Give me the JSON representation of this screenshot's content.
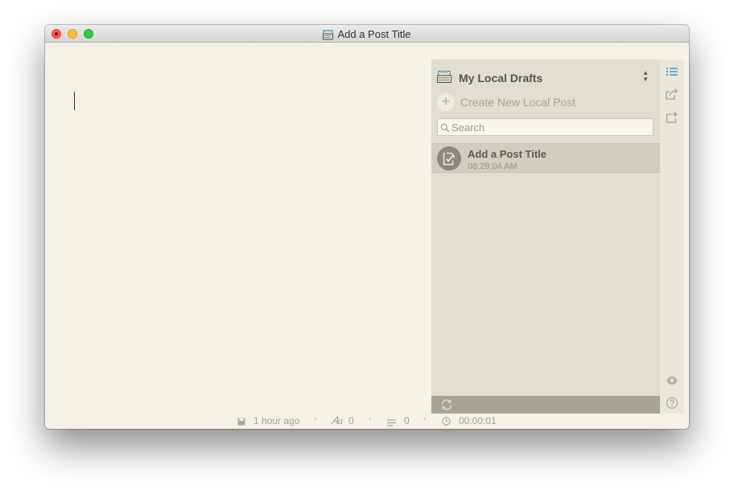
{
  "window": {
    "title": "Add a Post Title"
  },
  "sidebar": {
    "drafts_label": "My Local Drafts",
    "create_label": "Create New Local Post",
    "search_placeholder": "Search",
    "posts": [
      {
        "title": "Add a Post Title",
        "time": "08:29:04 AM"
      }
    ]
  },
  "status": {
    "saved": "1 hour ago",
    "characters": "0",
    "paragraphs": "0",
    "elapsed": "00:00:01"
  },
  "icons": {
    "drafts": "typewriter-icon",
    "create": "plus-circle-icon",
    "search": "search-icon",
    "post": "document-check-icon",
    "sync": "sync-icon",
    "list": "list-icon",
    "share": "share-icon",
    "export": "export-icon",
    "preview": "eye-icon",
    "help": "help-icon",
    "save": "disk-icon",
    "font": "font-icon",
    "lines": "lines-icon",
    "clock": "clock-icon"
  },
  "colors": {
    "accent": "#3a9fc9",
    "editor_bg": "#f5f1e7",
    "panel_bg": "#e0ddd3"
  }
}
